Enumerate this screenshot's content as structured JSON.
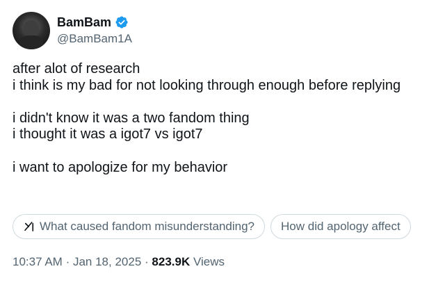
{
  "author": {
    "display_name": "BamBam",
    "handle": "@BamBam1A",
    "verified_color": "#1d9bf0"
  },
  "tweet": {
    "lines": [
      "after alot of research",
      "i think is my bad for not looking through enough before replying",
      "",
      "i didn't know it was a two fandom thing",
      "i thought it was a igot7 vs igot7",
      "",
      "i want to apologize for my behavior"
    ]
  },
  "suggestions": [
    {
      "label": "What caused fandom misunderstanding?",
      "icon": "grok-icon"
    },
    {
      "label": "How did apology affect"
    }
  ],
  "meta": {
    "time": "10:37 AM",
    "separator": "·",
    "date": "Jan 18, 2025",
    "views_count": "823.9K",
    "views_label": "Views"
  }
}
